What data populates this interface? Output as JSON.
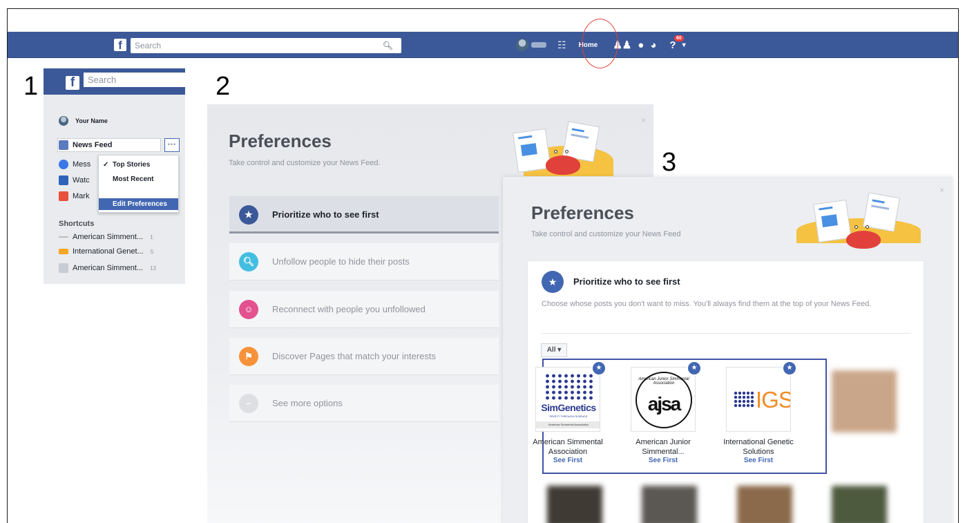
{
  "steps": [
    "1",
    "2",
    "3"
  ],
  "topbar": {
    "search_placeholder": "Search",
    "home_label": "Home",
    "notifications_badge": "60",
    "brand_color": "#3b5998"
  },
  "panel1": {
    "search_placeholder": "Search",
    "user_name": "Your Name",
    "nav": [
      {
        "label": "News Feed",
        "icon": "news-feed-icon"
      },
      {
        "label": "Mess",
        "icon": "messenger-icon"
      },
      {
        "label": "Watc",
        "icon": "watch-icon"
      },
      {
        "label": "Mark",
        "icon": "marketplace-icon"
      }
    ],
    "more_button": "•••",
    "menu": {
      "items": [
        "Top Stories",
        "Most Recent",
        "Edit Preferences"
      ],
      "checked": "Top Stories"
    },
    "shortcuts_heading": "Shortcuts",
    "shortcuts": [
      {
        "label": "American Simment...",
        "count": "1"
      },
      {
        "label": "International Genet...",
        "count": "5"
      },
      {
        "label": "American Simment...",
        "count": "13"
      }
    ]
  },
  "panel2": {
    "title": "Preferences",
    "subtitle": "Take control and customize your News Feed.",
    "options": [
      {
        "label": "Prioritize who to see first",
        "icon": "star-icon",
        "color": "#3b5998"
      },
      {
        "label": "Unfollow people to hide their posts",
        "icon": "search-icon",
        "color": "#44bee0"
      },
      {
        "label": "Reconnect with people you unfollowed",
        "icon": "smile-icon",
        "color": "#e3518f"
      },
      {
        "label": "Discover Pages that match your interests",
        "icon": "flag-icon",
        "color": "#f7923a"
      },
      {
        "label": "See more options",
        "icon": "more-icon",
        "color": "#dddfe2"
      }
    ]
  },
  "panel3": {
    "title": "Preferences",
    "subtitle": "Take control and customize your News Feed",
    "section_title": "Prioritize who to see first",
    "section_desc": "Choose whose posts you don't want to miss. You'll always find them at the top of your News Feed.",
    "filter_label": "All ▾",
    "pages": [
      {
        "name": "American Simmental Association",
        "action": "See First",
        "logo_text": "SimGenetics",
        "logo_sub": "PROFIT THROUGH SCIENCE",
        "logo_bar": "American Simmental Association"
      },
      {
        "name": "American Junior Simmental...",
        "action": "See First",
        "logo_text": "ajsa",
        "logo_sub": "American Junior Simmental Association"
      },
      {
        "name": "International Genetic Solutions",
        "action": "See First",
        "logo_text": "IGS"
      }
    ]
  }
}
